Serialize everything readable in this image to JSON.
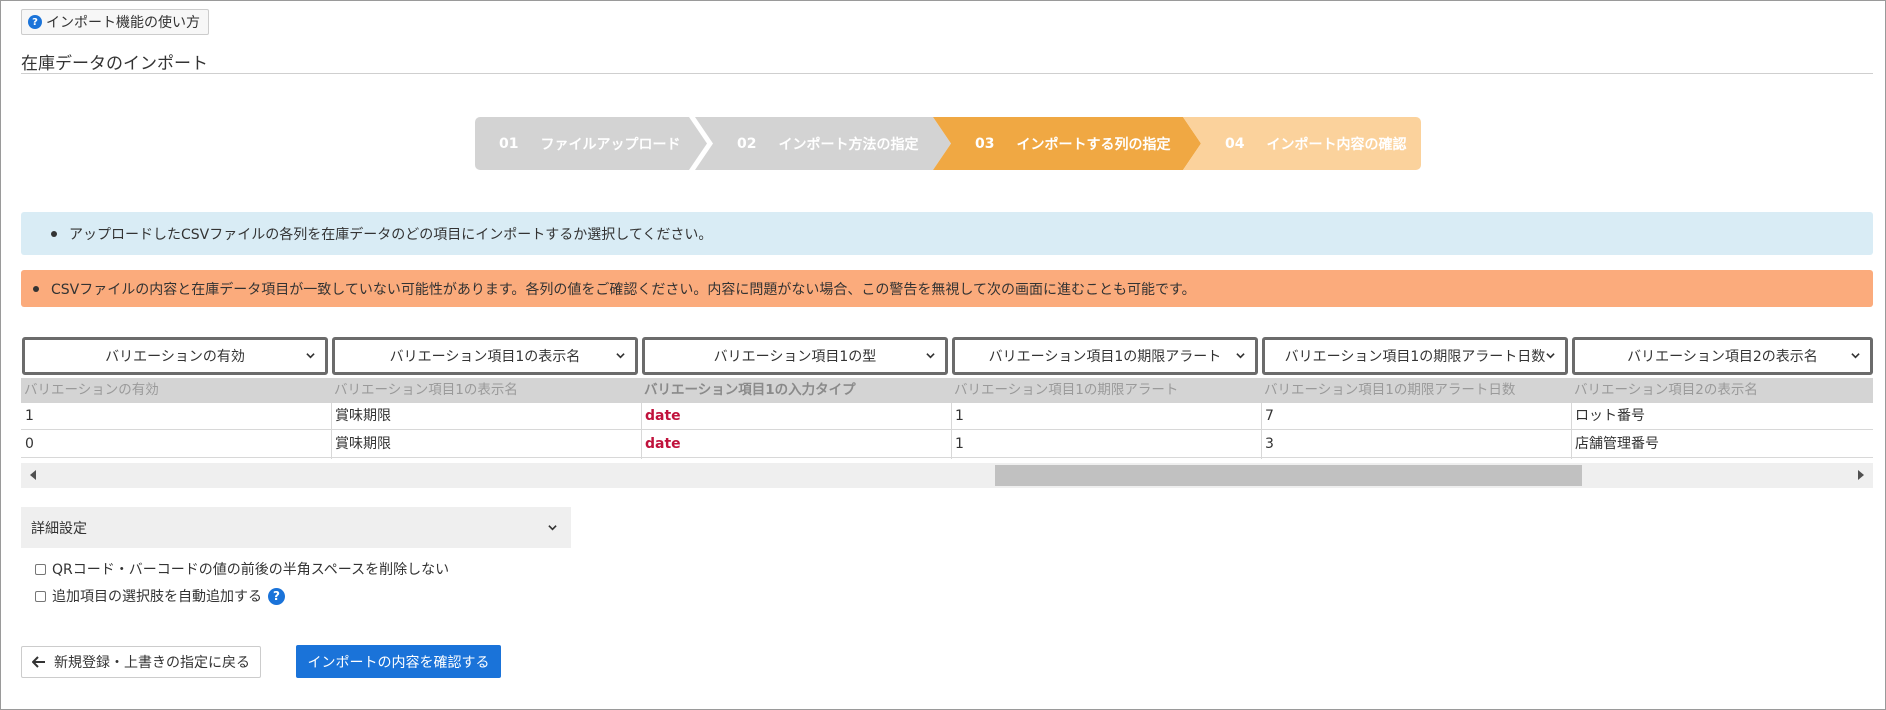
{
  "help_button": {
    "label": "インポート機能の使い方",
    "icon": "question-icon"
  },
  "page_title": "在庫データのインポート",
  "steps": [
    {
      "num": "01",
      "label": "ファイルアップロード",
      "state": "done"
    },
    {
      "num": "02",
      "label": "インポート方法の指定",
      "state": "done"
    },
    {
      "num": "03",
      "label": "インポートする列の指定",
      "state": "active"
    },
    {
      "num": "04",
      "label": "インポート内容の確認",
      "state": "upcoming"
    }
  ],
  "alerts": {
    "info": "アップロードしたCSVファイルの各列を在庫データのどの項目にインポートするか選択してください。",
    "warning": "CSVファイルの内容と在庫データ項目が一致していない可能性があります。各列の値をご確認ください。内容に問題がない場合、この警告を無視して次の画面に進むことも可能です。"
  },
  "columns": [
    {
      "selected": "バリエーションの有効",
      "header": "バリエーションの有効",
      "rows": [
        "1",
        "0"
      ]
    },
    {
      "selected": "バリエーション項目1の表示名",
      "header": "バリエーション項目1の表示名",
      "rows": [
        "賞味期限",
        "賞味期限"
      ]
    },
    {
      "selected": "バリエーション項目1の型",
      "header": "バリエーション項目1の入力タイプ",
      "rows": [
        "date",
        "date"
      ]
    },
    {
      "selected": "バリエーション項目1の期限アラート",
      "header": "バリエーション項目1の期限アラート",
      "rows": [
        "1",
        "1"
      ]
    },
    {
      "selected": "バリエーション項目1の期限アラート日数",
      "header": "バリエーション項目1の期限アラート日数",
      "rows": [
        "7",
        "3"
      ]
    },
    {
      "selected": "バリエーション項目2の表示名",
      "header": "バリエーション項目2の表示名",
      "rows": [
        "ロット番号",
        "店舗管理番号"
      ]
    }
  ],
  "advanced": {
    "label": "詳細設定",
    "options": [
      {
        "label": "QRコード・バーコードの値の前後の半角スペースを削除しない",
        "checked": false
      },
      {
        "label": "追加項目の選択肢を自動追加する",
        "checked": false
      }
    ]
  },
  "footer": {
    "back_label": "新規登録・上書きの指定に戻る",
    "confirm_label": "インポートの内容を確認する"
  },
  "colors": {
    "primary": "#1a73d9",
    "step_done": "#d3d3d3",
    "step_active": "#f0a843",
    "step_upcoming": "#fbd29c",
    "info_bg": "#d9ecf5",
    "warning_bg": "#fbab7c",
    "date_text": "#c0123c"
  }
}
